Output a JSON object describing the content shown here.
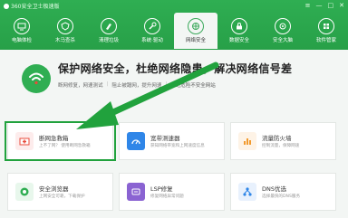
{
  "window": {
    "title": "360安全卫士极速版",
    "controls": [
      "≡",
      "—",
      "□",
      "✕"
    ]
  },
  "nav": [
    {
      "label": "电脑体检",
      "icon": "monitor-check-icon"
    },
    {
      "label": "木马查杀",
      "icon": "shield-icon"
    },
    {
      "label": "清理垃圾",
      "icon": "broom-icon"
    },
    {
      "label": "系统·驱动",
      "icon": "wrench-icon"
    },
    {
      "label": "网络安全",
      "icon": "network-icon",
      "active": true
    },
    {
      "label": "数据安全",
      "icon": "data-lock-icon"
    },
    {
      "label": "安全大脑",
      "icon": "brain-icon"
    },
    {
      "label": "软件管家",
      "icon": "grid-apps-icon"
    }
  ],
  "hero": {
    "title": "保护网络安全，杜绝网络隐患，解决网络信号差",
    "tags": [
      "断网修复，网速测试",
      "阻止被蹭网，提升网速",
      "杜绝危险不安全网站"
    ]
  },
  "cards": [
    {
      "title": "断网急救箱",
      "desc": "上不了网？ 使用断网急救箱",
      "icon": "first-aid-icon",
      "color": "#e94b3c"
    },
    {
      "title": "宽带测速器",
      "desc": "获知网络带宽和上网速度信息",
      "icon": "speedometer-icon",
      "color": "#2f86e8"
    },
    {
      "title": "流量防火墙",
      "desc": "控制流量，保障网速",
      "icon": "chart-icon",
      "color": "#f29a2e"
    },
    {
      "title": "安全浏览器",
      "desc": "上网安全可靠，下载保护",
      "icon": "browser-icon",
      "color": "#2fae52"
    },
    {
      "title": "LSP修复",
      "desc": "修复网络异常问题",
      "icon": "repair-icon",
      "color": "#8a63d2"
    },
    {
      "title": "DNS优选",
      "desc": "选择最快的DNS服务",
      "icon": "dns-icon",
      "color": "#2f86e8"
    }
  ],
  "colors": {
    "brand": "#2fae52",
    "highlight": "#21a23d"
  }
}
